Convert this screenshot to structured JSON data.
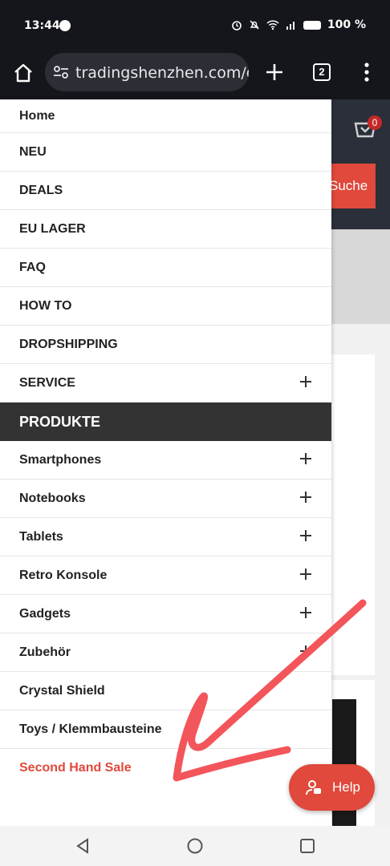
{
  "status_bar": {
    "time": "13:44",
    "battery": "100 %"
  },
  "browser": {
    "url": "tradingshenzhen.com/de",
    "tab_count": "2"
  },
  "background_page": {
    "cart_count": "0",
    "search_label": "Suche"
  },
  "menu": {
    "items": [
      {
        "label": "Home",
        "expandable": false
      },
      {
        "label": "NEU",
        "expandable": false
      },
      {
        "label": "DEALS",
        "expandable": false
      },
      {
        "label": "EU LAGER",
        "expandable": false
      },
      {
        "label": "FAQ",
        "expandable": false
      },
      {
        "label": "HOW TO",
        "expandable": false
      },
      {
        "label": "DROPSHIPPING",
        "expandable": false
      },
      {
        "label": "SERVICE",
        "expandable": true
      }
    ],
    "section_title": "PRODUKTE",
    "product_items": [
      {
        "label": "Smartphones",
        "expandable": true
      },
      {
        "label": "Notebooks",
        "expandable": true
      },
      {
        "label": "Tablets",
        "expandable": true
      },
      {
        "label": "Retro Konsole",
        "expandable": true
      },
      {
        "label": "Gadgets",
        "expandable": true
      },
      {
        "label": "Zubehör",
        "expandable": true
      },
      {
        "label": "Crystal Shield",
        "expandable": false
      },
      {
        "label": "Toys / Klemmbausteine",
        "expandable": false
      }
    ],
    "sale_item": "Second Hand Sale"
  },
  "help_button": {
    "label": "Help"
  },
  "colors": {
    "accent": "#e0493b",
    "section_bg": "#333333",
    "annotation_arrow": "#f2555a"
  }
}
